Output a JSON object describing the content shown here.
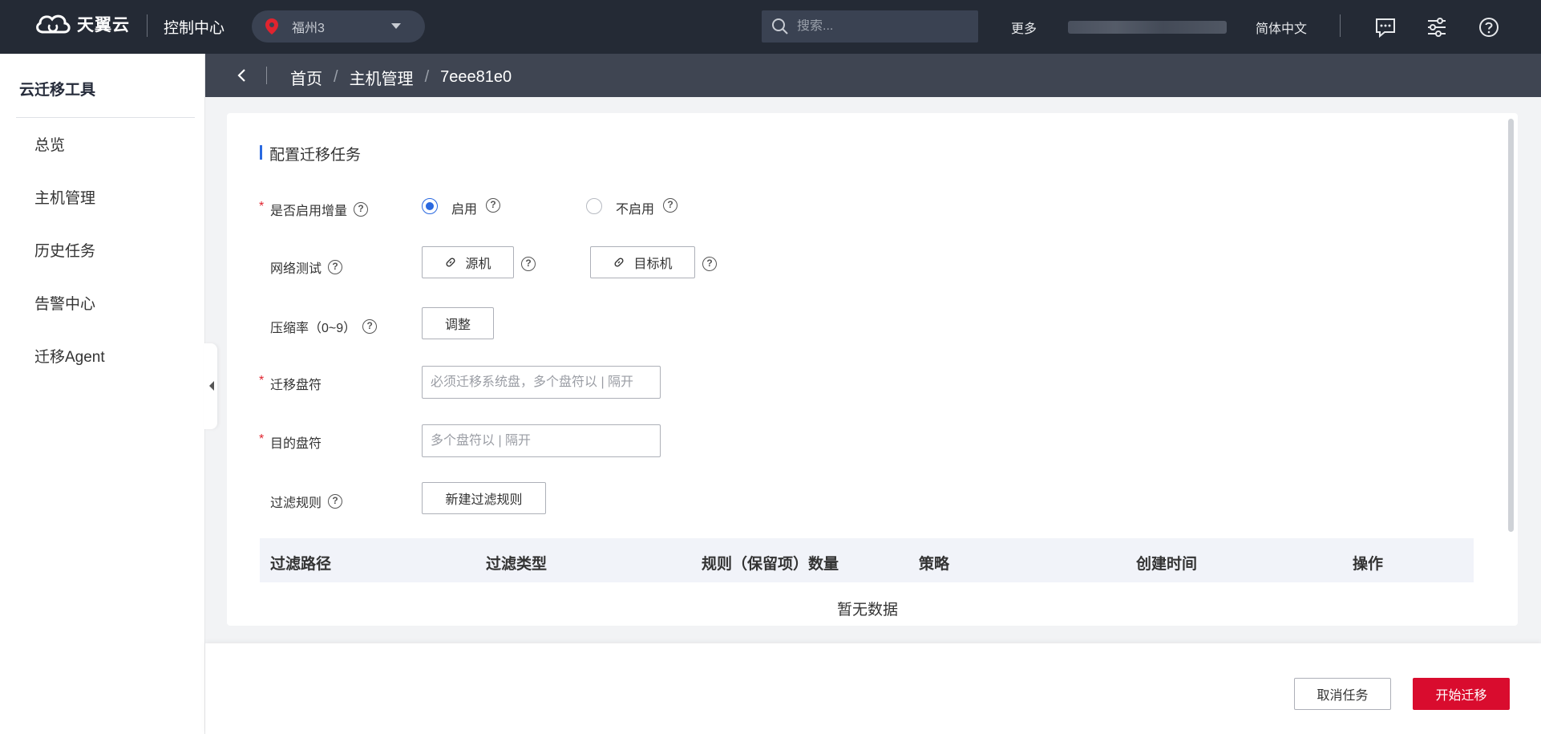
{
  "topbar": {
    "brand": "天翼云",
    "console_title": "控制中心",
    "region": "福州3",
    "search_placeholder": "搜索...",
    "more": "更多",
    "language": "简体中文"
  },
  "breadcrumb": [
    "首页",
    "主机管理",
    "7eee81e0"
  ],
  "sidebar": {
    "title": "云迁移工具",
    "items": [
      {
        "label": "总览"
      },
      {
        "label": "主机管理"
      },
      {
        "label": "历史任务"
      },
      {
        "label": "告警中心"
      },
      {
        "label": "迁移Agent"
      }
    ]
  },
  "form": {
    "section_title": "配置迁移任务",
    "incremental": {
      "label": "是否启用增量",
      "options": [
        "启用",
        "不启用"
      ],
      "selected": "启用"
    },
    "network_test": {
      "label": "网络测试",
      "source_button": "源机",
      "target_button": "目标机"
    },
    "compression": {
      "label": "压缩率（0~9）",
      "button": "调整"
    },
    "migrate_drives": {
      "label": "迁移盘符",
      "placeholder": "必须迁移系统盘，多个盘符以 | 隔开"
    },
    "target_drives": {
      "label": "目的盘符",
      "placeholder": "多个盘符以 | 隔开"
    },
    "filter_rules": {
      "label": "过滤规则",
      "button": "新建过滤规则"
    }
  },
  "table": {
    "columns": [
      "过滤路径",
      "过滤类型",
      "规则（保留项）数量",
      "策略",
      "创建时间",
      "操作"
    ],
    "empty_text": "暂无数据"
  },
  "footer": {
    "cancel": "取消任务",
    "start": "开始迁移"
  },
  "colors": {
    "accent": "#2a69e0",
    "primary_button": "#d90c2e",
    "topbar": "#242a35"
  }
}
